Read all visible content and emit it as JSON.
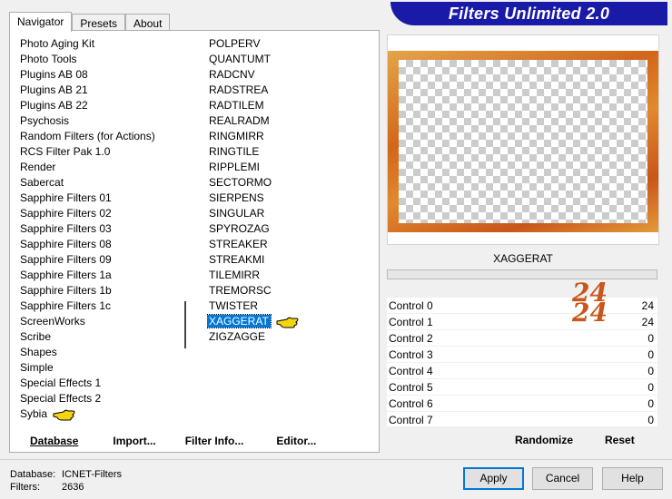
{
  "banner": {
    "title": "Filters Unlimited 2.0"
  },
  "tabs": [
    {
      "label": "Navigator"
    },
    {
      "label": "Presets"
    },
    {
      "label": "About"
    }
  ],
  "categories": [
    "Photo Aging Kit",
    "Photo Tools",
    "Plugins AB 08",
    "Plugins AB 21",
    "Plugins AB 22",
    "Psychosis",
    "Random Filters (for Actions)",
    "RCS Filter Pak 1.0",
    "Render",
    "Sabercat",
    "Sapphire Filters 01",
    "Sapphire Filters 02",
    "Sapphire Filters 03",
    "Sapphire Filters 08",
    "Sapphire Filters 09",
    "Sapphire Filters 1a",
    "Sapphire Filters 1b",
    "Sapphire Filters 1c",
    "ScreenWorks",
    "Scribe",
    "Shapes",
    "Simple",
    "Special Effects 1",
    "Special Effects 2",
    "Sybia"
  ],
  "filters": [
    "POLPERV",
    "QUANTUMT",
    "RADCNV",
    "RADSTREA",
    "RADTILEM",
    "REALRADM",
    "RINGMIRR",
    "RINGTILE",
    "RIPPLEMI",
    "SECTORMO",
    "SIERPENS",
    "SINGULAR",
    "SPYROZAG",
    "STREAKER",
    "STREAKMI",
    "TILEMIRR",
    "TREMORSC",
    "TWISTER",
    "XAGGERAT",
    "ZIGZAGGE"
  ],
  "selected_filter": "XAGGERAT",
  "toolbar": {
    "database": "Database",
    "import": "Import...",
    "filter_info": "Filter Info...",
    "editor": "Editor..."
  },
  "filter_title": "XAGGERAT",
  "controls": [
    {
      "label": "Control 0",
      "value": "24"
    },
    {
      "label": "Control 1",
      "value": "24"
    },
    {
      "label": "Control 2",
      "value": "0"
    },
    {
      "label": "Control 3",
      "value": "0"
    },
    {
      "label": "Control 4",
      "value": "0"
    },
    {
      "label": "Control 5",
      "value": "0"
    },
    {
      "label": "Control 6",
      "value": "0"
    },
    {
      "label": "Control 7",
      "value": "0"
    }
  ],
  "annotation": {
    "line1": "24",
    "line2": "24"
  },
  "right_buttons": {
    "randomize": "Randomize",
    "reset": "Reset"
  },
  "footer": {
    "database_label": "Database:",
    "database_value": "ICNET-Filters",
    "filters_label": "Filters:",
    "filters_value": "2636"
  },
  "dialog": {
    "apply": "Apply",
    "cancel": "Cancel",
    "help": "Help"
  },
  "colors": {
    "banner": "#1a1aa8",
    "selection": "#0078d7",
    "frame_orange": "#d2661b",
    "annotation": "#c9561a"
  }
}
